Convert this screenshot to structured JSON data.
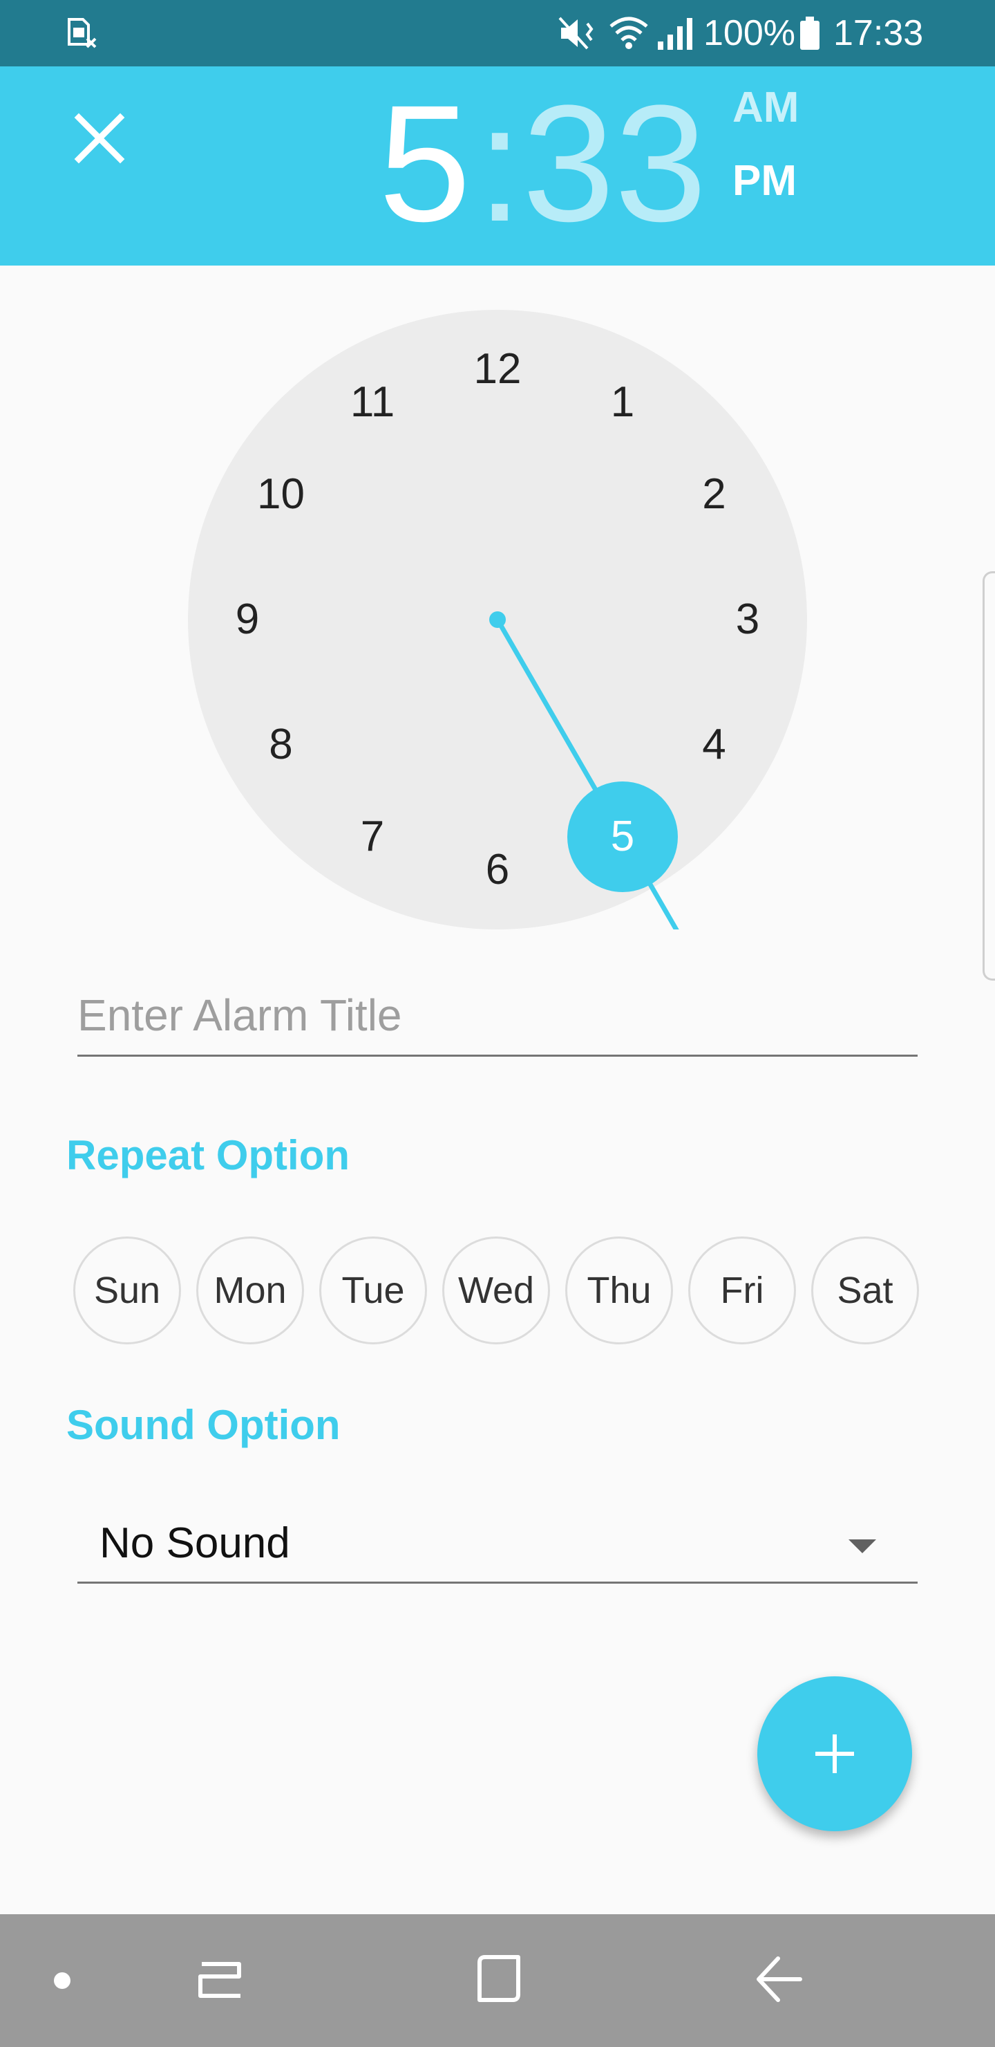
{
  "status_bar": {
    "battery": "100%",
    "time": "17:33",
    "icons": [
      "sim-card-icon",
      "vibrate-mute-icon",
      "wifi-icon",
      "signal-icon",
      "battery-icon"
    ]
  },
  "header": {
    "hour": "5",
    "separator": ":",
    "minute": "33",
    "am_label": "AM",
    "pm_label": "PM",
    "selected_period": "PM",
    "close_icon": "close-icon",
    "accent_color": "#3fcdec"
  },
  "clock": {
    "numbers": [
      "12",
      "1",
      "2",
      "3",
      "4",
      "6",
      "7",
      "8",
      "9",
      "10",
      "11"
    ],
    "selected": "5"
  },
  "alarm_title": {
    "placeholder": "Enter Alarm Title",
    "value": ""
  },
  "repeat": {
    "heading": "Repeat Option",
    "days": [
      "Sun",
      "Mon",
      "Tue",
      "Wed",
      "Thu",
      "Fri",
      "Sat"
    ]
  },
  "sound": {
    "heading": "Sound Option",
    "selected": "No Sound"
  },
  "fab": {
    "icon": "plus-icon"
  },
  "nav_bar": {
    "icons": [
      "dot-icon",
      "recents-icon",
      "home-icon",
      "back-icon"
    ]
  }
}
